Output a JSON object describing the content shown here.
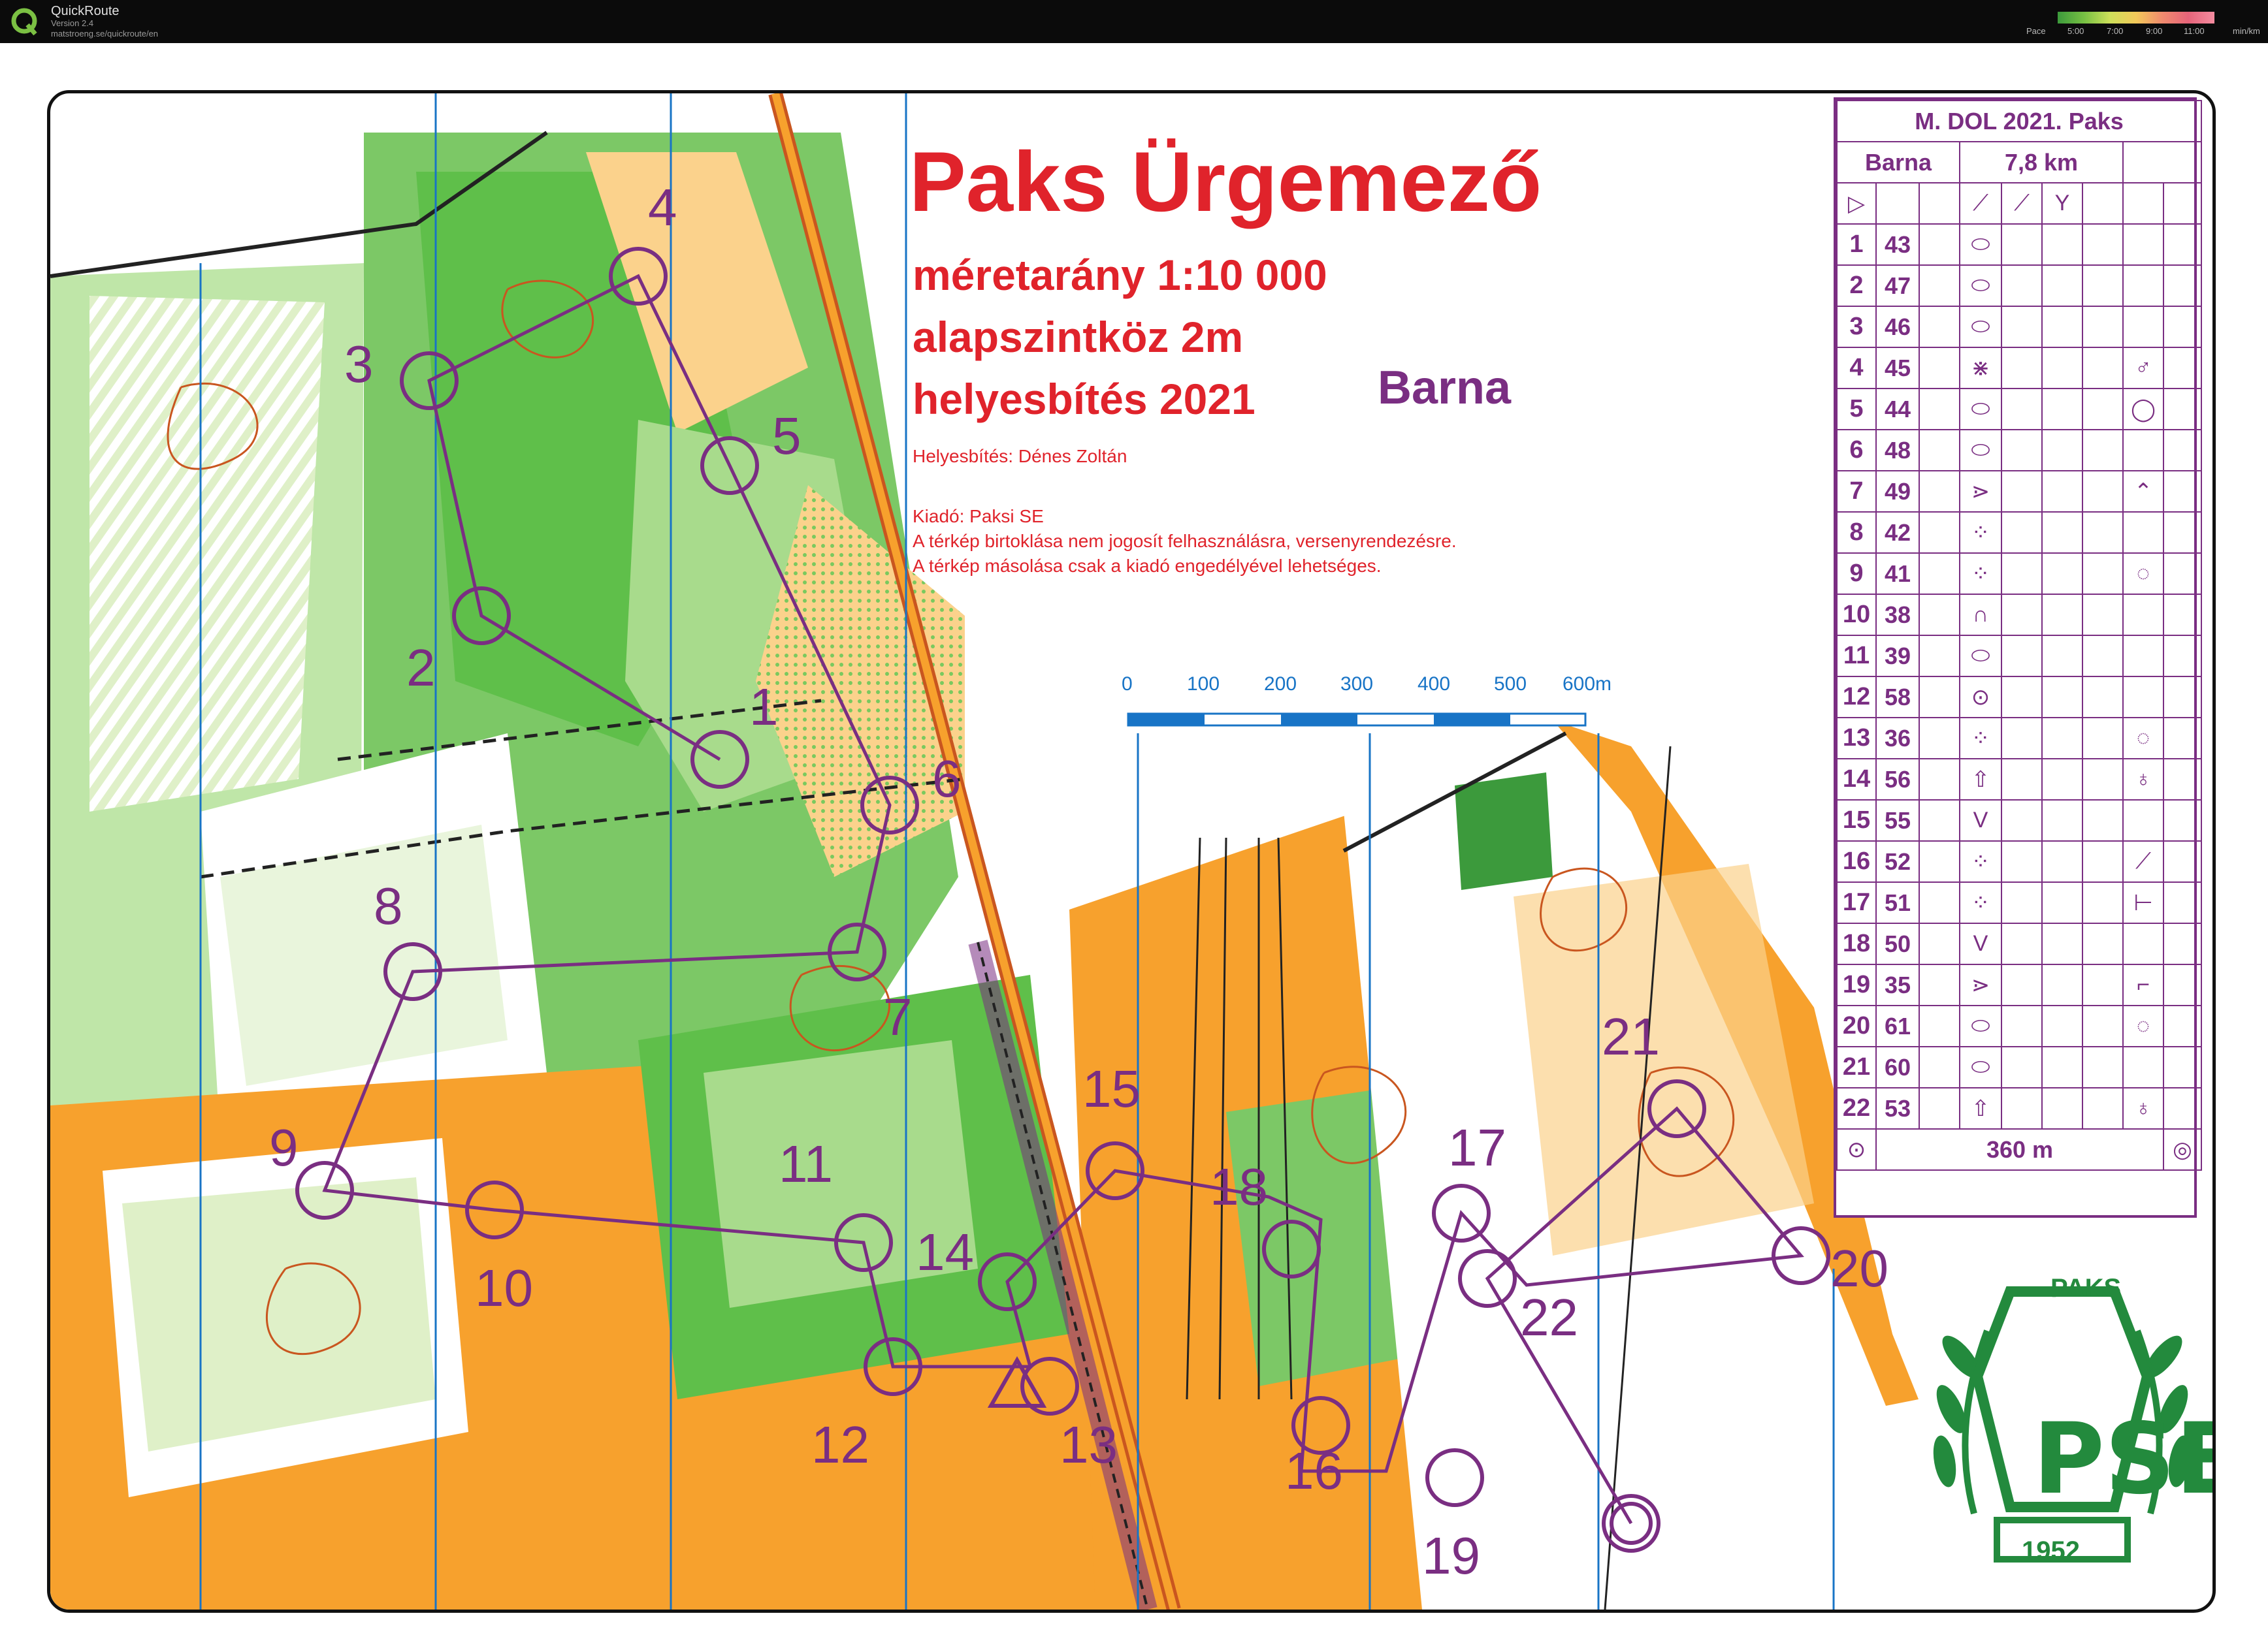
{
  "app": {
    "name": "QuickRoute",
    "version": "Version 2.4",
    "url": "matstroeng.se/quickroute/en",
    "pace_legend": {
      "label": "Pace",
      "ticks": [
        "5:00",
        "7:00",
        "9:00",
        "11:00"
      ],
      "unit": "min/km"
    }
  },
  "map": {
    "title": "Paks Ürgemező",
    "scale": "méretarány 1:10 000",
    "contour": "alapszintköz 2m",
    "revision": "helyesbítés 2021",
    "course_name": "Barna",
    "corrected_by": "Helyesbítés: Dénes Zoltán",
    "publisher": "Kiadó: Paksi SE",
    "copy_note_1": "A térkép birtoklása nem jogosít felhasználásra, versenyrendezésre.",
    "copy_note_2": "A térkép másolása csak a kiadó engedélyével lehetséges.",
    "scale_bar_labels": [
      "0",
      "100",
      "200",
      "300",
      "400",
      "500",
      "600m"
    ],
    "controls": [
      {
        "num": "1"
      },
      {
        "num": "2"
      },
      {
        "num": "3"
      },
      {
        "num": "4"
      },
      {
        "num": "5"
      },
      {
        "num": "6"
      },
      {
        "num": "7"
      },
      {
        "num": "8"
      },
      {
        "num": "9"
      },
      {
        "num": "10"
      },
      {
        "num": "11"
      },
      {
        "num": "12"
      },
      {
        "num": "13"
      },
      {
        "num": "14"
      },
      {
        "num": "15"
      },
      {
        "num": "16"
      },
      {
        "num": "17"
      },
      {
        "num": "18"
      },
      {
        "num": "19"
      },
      {
        "num": "20"
      },
      {
        "num": "21"
      },
      {
        "num": "22"
      }
    ],
    "colors": {
      "course": "#7a2e82",
      "forest_green": "#5fbf4a",
      "light_green": "#a8db8c",
      "open_orange": "#f7a12d",
      "light_orange": "#fbd28c",
      "contour_brown": "#c9561f",
      "grid_blue": "#1874c6"
    }
  },
  "description_sheet": {
    "event": "M. DOL 2021. Paks",
    "course": "Barna",
    "length": "7,8 km",
    "rows": [
      {
        "no": "1",
        "code": "43",
        "sym_d": "⬭",
        "sym_g": ""
      },
      {
        "no": "2",
        "code": "47",
        "sym_d": "⬭",
        "sym_g": ""
      },
      {
        "no": "3",
        "code": "46",
        "sym_d": "⬭",
        "sym_g": ""
      },
      {
        "no": "4",
        "code": "45",
        "sym_d": "⋇",
        "sym_g": "♂"
      },
      {
        "no": "5",
        "code": "44",
        "sym_d": "⬭",
        "sym_g": "◯"
      },
      {
        "no": "6",
        "code": "48",
        "sym_d": "⬭",
        "sym_g": ""
      },
      {
        "no": "7",
        "code": "49",
        "sym_d": "⋗",
        "sym_g": "⌃"
      },
      {
        "no": "8",
        "code": "42",
        "sym_d": "⁘",
        "sym_g": ""
      },
      {
        "no": "9",
        "code": "41",
        "sym_d": "⁘",
        "sym_g": "◌"
      },
      {
        "no": "10",
        "code": "38",
        "sym_d": "∩",
        "sym_g": ""
      },
      {
        "no": "11",
        "code": "39",
        "sym_d": "⬭",
        "sym_g": ""
      },
      {
        "no": "12",
        "code": "58",
        "sym_d": "⊙",
        "sym_g": ""
      },
      {
        "no": "13",
        "code": "36",
        "sym_d": "⁘",
        "sym_g": "◌"
      },
      {
        "no": "14",
        "code": "56",
        "sym_d": "⇧",
        "sym_g": "♁"
      },
      {
        "no": "15",
        "code": "55",
        "sym_d": "V",
        "sym_g": ""
      },
      {
        "no": "16",
        "code": "52",
        "sym_d": "⁘",
        "sym_g": "⟋"
      },
      {
        "no": "17",
        "code": "51",
        "sym_d": "⁘",
        "sym_g": "⊢"
      },
      {
        "no": "18",
        "code": "50",
        "sym_d": "V",
        "sym_g": ""
      },
      {
        "no": "19",
        "code": "35",
        "sym_d": "⋗",
        "sym_g": "⌐"
      },
      {
        "no": "20",
        "code": "61",
        "sym_d": "⬭",
        "sym_g": "◌"
      },
      {
        "no": "21",
        "code": "60",
        "sym_d": "⬭",
        "sym_g": ""
      },
      {
        "no": "22",
        "code": "53",
        "sym_d": "⇧",
        "sym_g": "♁"
      }
    ],
    "finish": "360 m"
  },
  "club_logo": {
    "name": "PAKS",
    "monogram": "PSE",
    "year": "1952"
  }
}
